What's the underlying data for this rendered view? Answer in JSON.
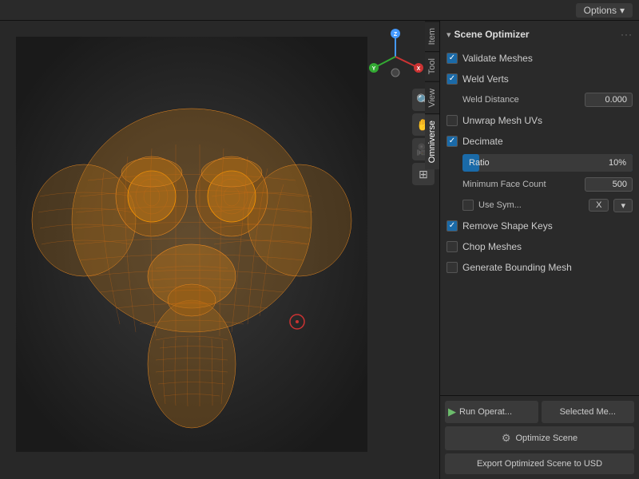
{
  "topbar": {
    "options_label": "Options",
    "options_arrow": "▾"
  },
  "side_tabs": [
    {
      "id": "item",
      "label": "Item"
    },
    {
      "id": "tool",
      "label": "Tool"
    },
    {
      "id": "view",
      "label": "View"
    },
    {
      "id": "omniverse",
      "label": "Omniverse",
      "active": true
    }
  ],
  "panel": {
    "arrow": "▾",
    "title": "Scene Optimizer",
    "dots": "···",
    "items": [
      {
        "id": "validate_meshes",
        "type": "checkbox",
        "checked": true,
        "label": "Validate Meshes"
      },
      {
        "id": "weld_verts",
        "type": "checkbox",
        "checked": true,
        "label": "Weld Verts"
      },
      {
        "id": "weld_distance",
        "type": "field",
        "label": "Weld Distance",
        "value": "0.000",
        "indent": true
      },
      {
        "id": "unwrap_mesh_uvs",
        "type": "checkbox",
        "checked": false,
        "label": "Unwrap Mesh UVs"
      },
      {
        "id": "decimate",
        "type": "checkbox",
        "checked": true,
        "label": "Decimate"
      },
      {
        "id": "ratio_slider",
        "type": "slider",
        "label": "Ratio",
        "value": "10%",
        "fill_pct": 10
      },
      {
        "id": "min_face_count",
        "type": "field",
        "label": "Minimum Face Count",
        "value": "500",
        "indent": true
      },
      {
        "id": "use_sym",
        "type": "use_sym",
        "label": "Use Sym...",
        "x_val": "X",
        "dropdown": "▾"
      },
      {
        "id": "remove_shape_keys",
        "type": "checkbox",
        "checked": true,
        "label": "Remove Shape Keys"
      },
      {
        "id": "chop_meshes",
        "type": "checkbox",
        "checked": false,
        "label": "Chop Meshes"
      },
      {
        "id": "generate_bounding_mesh",
        "type": "checkbox",
        "checked": false,
        "label": "Generate Bounding Mesh"
      }
    ]
  },
  "bottom_buttons": {
    "run_label": "Run Operat...",
    "selected_me_label": "Selected Me...",
    "optimize_label": "Optimize Scene",
    "export_label": "Export Optimized Scene to USD"
  },
  "viewport_icons": [
    {
      "id": "zoom",
      "icon": "🔍"
    },
    {
      "id": "hand",
      "icon": "✋"
    },
    {
      "id": "camera",
      "icon": "🎥"
    },
    {
      "id": "grid",
      "icon": "⊞"
    }
  ]
}
